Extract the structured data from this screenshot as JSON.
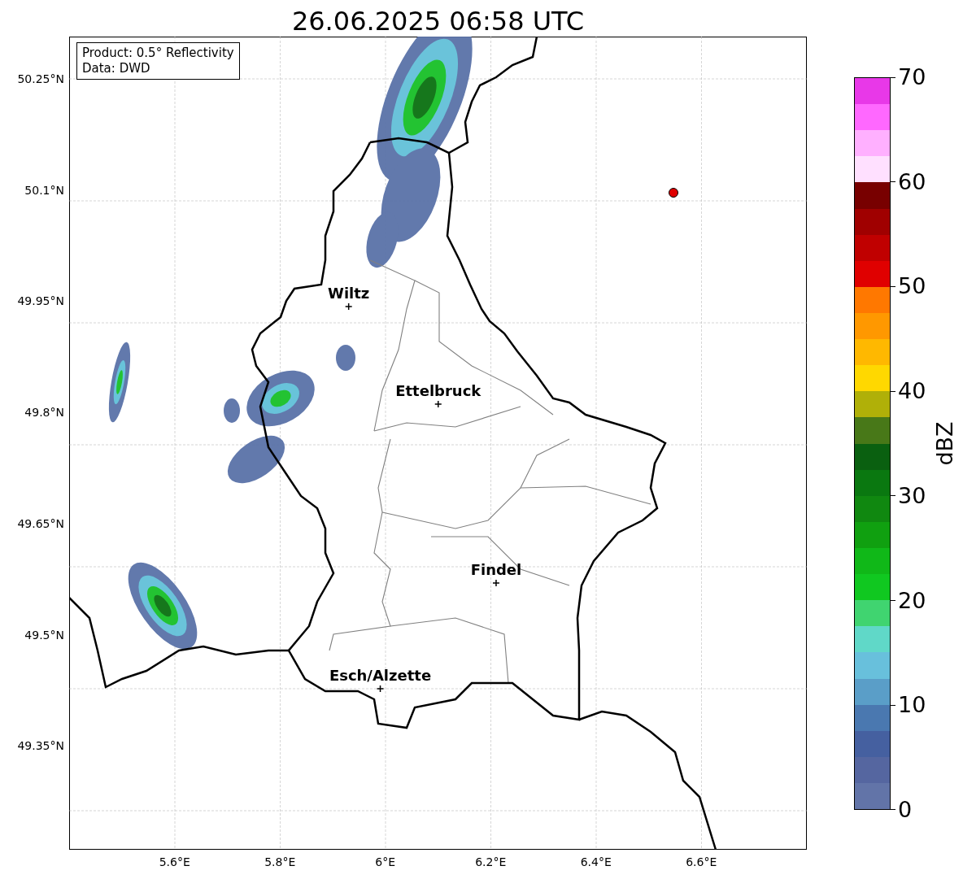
{
  "title": "26.06.2025 06:58 UTC",
  "legend": {
    "lines": [
      "Product: 0.5° Reflectivity",
      "Data: DWD"
    ]
  },
  "yticks": [
    "50.25°N",
    "50.1°N",
    "49.95°N",
    "49.8°N",
    "49.65°N",
    "49.5°N",
    "49.35°N"
  ],
  "xticks": [
    "5.6°E",
    "5.8°E",
    "6°E",
    "6.2°E",
    "6.4°E",
    "6.6°E"
  ],
  "cities": [
    {
      "label": "Wiltz"
    },
    {
      "label": "Ettelbruck"
    },
    {
      "label": "Findel"
    },
    {
      "label": "Esch/Alzette"
    }
  ],
  "colorbar": {
    "label": "dBZ",
    "ticks": [
      "70",
      "60",
      "50",
      "40",
      "30",
      "20",
      "10",
      "0"
    ],
    "bins": [
      {
        "color": "#e838e8"
      },
      {
        "color": "#ff68ff"
      },
      {
        "color": "#ffb0ff"
      },
      {
        "color": "#ffe0ff"
      },
      {
        "color": "#780000"
      },
      {
        "color": "#a00000"
      },
      {
        "color": "#c00000"
      },
      {
        "color": "#e00000"
      },
      {
        "color": "#ff7800"
      },
      {
        "color": "#ff9800"
      },
      {
        "color": "#ffb800"
      },
      {
        "color": "#ffd800"
      },
      {
        "color": "#b0b008"
      },
      {
        "color": "#487818"
      },
      {
        "color": "#0a6010"
      },
      {
        "color": "#0a7810"
      },
      {
        "color": "#108810"
      },
      {
        "color": "#10a010"
      },
      {
        "color": "#10b818"
      },
      {
        "color": "#10c820"
      },
      {
        "color": "#40d470"
      },
      {
        "color": "#60d8c8"
      },
      {
        "color": "#68c0dc"
      },
      {
        "color": "#5a9ec8"
      },
      {
        "color": "#4a78b0"
      },
      {
        "color": "#4560a0"
      },
      {
        "color": "#5566a0"
      },
      {
        "color": "#6274a8"
      }
    ]
  }
}
